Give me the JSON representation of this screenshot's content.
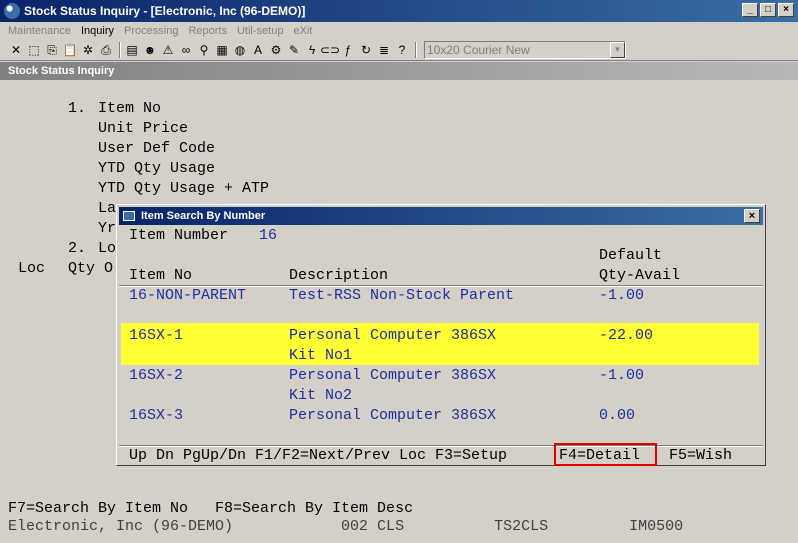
{
  "window": {
    "title": "Stock Status Inquiry - [Electronic, Inc (96-DEMO)]"
  },
  "menu": [
    "Maintenance",
    "Inquiry",
    "Processing",
    "Reports",
    "Util-setup",
    "eXit"
  ],
  "toolbar": {
    "font_select": "10x20 Courier New"
  },
  "mdi_title": "Stock Status Inquiry",
  "screen": {
    "options": [
      {
        "num": "1.",
        "label": "Item No"
      },
      {
        "num": "",
        "label": "Unit Price"
      },
      {
        "num": "",
        "label": "User Def Code"
      },
      {
        "num": "",
        "label": "YTD Qty Usage"
      },
      {
        "num": "",
        "label": "YTD Qty Usage + ATP"
      },
      {
        "num": "",
        "label": "La"
      },
      {
        "num": "",
        "label": "Yr"
      },
      {
        "num": "2.",
        "label": "Lo"
      }
    ],
    "col_loc": "Loc",
    "col_qty": "Qty O",
    "footer_keys": "F7=Search By Item No   F8=Search By Item Desc",
    "status_line": "Electronic, Inc (96-DEMO)            002 CLS          TS2CLS         IM0500"
  },
  "dialog": {
    "title": "Item Search By Number",
    "item_number_label": "Item Number",
    "item_number_value": "16",
    "headers": {
      "item_no": "Item No",
      "description": "Description",
      "default": "Default",
      "qty_avail": "Qty-Avail"
    },
    "rows": [
      {
        "item_no": "16-NON-PARENT",
        "desc1": "Test-RSS Non-Stock Parent",
        "desc2": "",
        "qty": "-1.00"
      },
      {
        "item_no": "16SX-1",
        "desc1": "Personal Computer 386SX",
        "desc2": "Kit No1",
        "qty": "-22.00"
      },
      {
        "item_no": "16SX-2",
        "desc1": "Personal Computer 386SX",
        "desc2": "Kit No2",
        "qty": "-1.00"
      },
      {
        "item_no": "16SX-3",
        "desc1": "Personal Computer 386SX",
        "desc2": "",
        "qty": "0.00"
      }
    ],
    "keys": {
      "nav": "Up Dn PgUp/Dn F1/F2=Next/Prev Loc F3=Setup",
      "f4": "F4=Detail",
      "f5": "F5=Wish"
    }
  },
  "colors": {
    "highlight": "#ffff33",
    "blue_text": "#1f2f9f",
    "red_box": "#e00000"
  }
}
